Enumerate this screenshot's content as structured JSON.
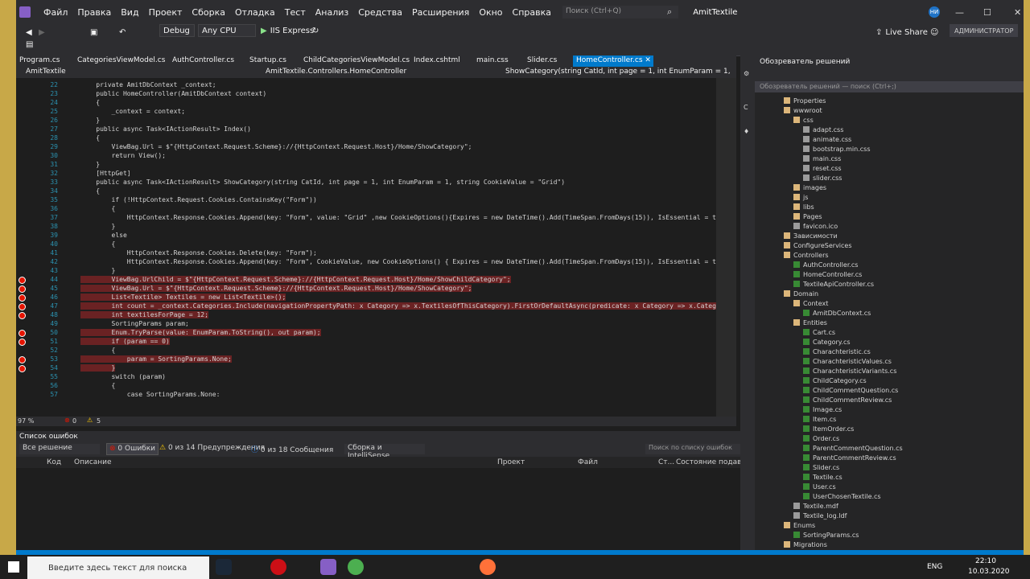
{
  "menu": {
    "items": [
      "Файл",
      "Правка",
      "Вид",
      "Проект",
      "Сборка",
      "Отладка",
      "Тест",
      "Анализ",
      "Средства",
      "Расширения",
      "Окно",
      "Справка"
    ],
    "search_placeholder": "Поиск (Ctrl+Q)",
    "solution_name": "AmitTextile",
    "user_initials": "НИ"
  },
  "toolbar": {
    "config": "Debug",
    "platform": "Any CPU",
    "run_label": "IIS Express",
    "live_share": "Live Share",
    "admin_label": "АДМИНИСТРАТОР"
  },
  "tabs": [
    "Program.cs",
    "CategoriesViewModel.cs",
    "AuthController.cs",
    "Startup.cs",
    "ChildCategoriesViewModel.cs",
    "Index.cshtml",
    "main.css",
    "Slider.cs",
    "HomeController.cs"
  ],
  "active_tab": "HomeController.cs",
  "navbar": {
    "project": "AmitTextile",
    "class": "AmitTextile.Controllers.HomeController",
    "member": "ShowCategory(string CatId, int page = 1, int EnumParam = 1, string CookieVa"
  },
  "code_lines": [
    {
      "n": "22",
      "t": "    private AmitDbContext _context;",
      "bp": false,
      "hl": false,
      "ref": "Ссылок: 0"
    },
    {
      "n": "23",
      "t": "    public HomeController(AmitDbContext context)",
      "bp": false,
      "hl": false,
      "ref": ""
    },
    {
      "n": "24",
      "t": "    {",
      "bp": false,
      "hl": false,
      "ref": ""
    },
    {
      "n": "25",
      "t": "        _context = context;",
      "bp": false,
      "hl": false,
      "ref": ""
    },
    {
      "n": "26",
      "t": "    }",
      "bp": false,
      "hl": false,
      "ref": "Ссылок: 0"
    },
    {
      "n": "27",
      "t": "    public async Task<IActionResult> Index()",
      "bp": false,
      "hl": false,
      "ref": ""
    },
    {
      "n": "28",
      "t": "    {",
      "bp": false,
      "hl": false,
      "ref": ""
    },
    {
      "n": "29",
      "t": "        ViewBag.Url = $\"{HttpContext.Request.Scheme}://{HttpContext.Request.Host}/Home/ShowCategory\";",
      "bp": false,
      "hl": false,
      "ref": ""
    },
    {
      "n": "30",
      "t": "        return View();",
      "bp": false,
      "hl": false,
      "ref": ""
    },
    {
      "n": "31",
      "t": "    }",
      "bp": false,
      "hl": false,
      "ref": ""
    },
    {
      "n": "32",
      "t": "    [HttpGet]",
      "bp": false,
      "hl": false,
      "ref": "Ссылок: 0"
    },
    {
      "n": "33",
      "t": "    public async Task<IActionResult> ShowCategory(string CatId, int page = 1, int EnumParam = 1, string CookieValue = \"Grid\")",
      "bp": false,
      "hl": false,
      "ref": ""
    },
    {
      "n": "34",
      "t": "    {",
      "bp": false,
      "hl": false,
      "ref": ""
    },
    {
      "n": "35",
      "t": "        if (!HttpContext.Request.Cookies.ContainsKey(\"Form\"))",
      "bp": false,
      "hl": false,
      "ref": ""
    },
    {
      "n": "36",
      "t": "        {",
      "bp": false,
      "hl": false,
      "ref": ""
    },
    {
      "n": "37",
      "t": "            HttpContext.Response.Cookies.Append(key: \"Form\", value: \"Grid\" ,new CookieOptions(){Expires = new DateTime().Add(TimeSpan.FromDays(15)), IsEssential = true });",
      "bp": false,
      "hl": false,
      "ref": ""
    },
    {
      "n": "38",
      "t": "        }",
      "bp": false,
      "hl": false,
      "ref": ""
    },
    {
      "n": "39",
      "t": "        else",
      "bp": false,
      "hl": false,
      "ref": ""
    },
    {
      "n": "40",
      "t": "        {",
      "bp": false,
      "hl": false,
      "ref": ""
    },
    {
      "n": "41",
      "t": "            HttpContext.Response.Cookies.Delete(key: \"Form\");",
      "bp": false,
      "hl": false,
      "ref": ""
    },
    {
      "n": "42",
      "t": "            HttpContext.Response.Cookies.Append(key: \"Form\", CookieValue, new CookieOptions() { Expires = new DateTime().Add(TimeSpan.FromDays(15)), IsEssential = true});",
      "bp": false,
      "hl": false,
      "ref": ""
    },
    {
      "n": "43",
      "t": "        }",
      "bp": false,
      "hl": false,
      "ref": ""
    },
    {
      "n": "44",
      "t": "        ViewBag.UrlChild = $\"{HttpContext.Request.Scheme}://{HttpContext.Request.Host}/Home/ShowChildCategory\";",
      "bp": true,
      "hl": true,
      "ref": ""
    },
    {
      "n": "45",
      "t": "        ViewBag.Url = $\"{HttpContext.Request.Scheme}://{HttpContext.Request.Host}/Home/ShowCategory\";",
      "bp": true,
      "hl": true,
      "ref": ""
    },
    {
      "n": "46",
      "t": "        List<Textile> Textiles = new List<Textile>();",
      "bp": true,
      "hl": true,
      "ref": ""
    },
    {
      "n": "47",
      "t": "        int count = _context.Categories.Include(navigationPropertyPath: x Category => x.TextilesOfThisCategory).FirstOrDefaultAsync(predicate: x Category => x.CategoryId == Guid.Parse(Cat",
      "bp": true,
      "hl": true,
      "ref": ""
    },
    {
      "n": "48",
      "t": "        int textilesForPage = 12;",
      "bp": true,
      "hl": true,
      "ref": ""
    },
    {
      "n": "49",
      "t": "        SortingParams param;",
      "bp": false,
      "hl": false,
      "ref": ""
    },
    {
      "n": "50",
      "t": "        Enum.TryParse(value: EnumParam.ToString(), out param);",
      "bp": true,
      "hl": true,
      "ref": ""
    },
    {
      "n": "51",
      "t": "        if (param == 0)",
      "bp": true,
      "hl": true,
      "ref": ""
    },
    {
      "n": "52",
      "t": "        {",
      "bp": false,
      "hl": false,
      "ref": ""
    },
    {
      "n": "53",
      "t": "            param = SortingParams.None;",
      "bp": true,
      "hl": true,
      "ref": ""
    },
    {
      "n": "54",
      "t": "        }",
      "bp": true,
      "hl": true,
      "ref": ""
    },
    {
      "n": "55",
      "t": "        switch (param)",
      "bp": false,
      "hl": false,
      "ref": ""
    },
    {
      "n": "56",
      "t": "        {",
      "bp": false,
      "hl": false,
      "ref": ""
    },
    {
      "n": "57",
      "t": "            case SortingParams.None:",
      "bp": false,
      "hl": false,
      "ref": ""
    }
  ],
  "editor_status": {
    "zoom": "97 %",
    "errors": "0",
    "warnings": "5"
  },
  "error_list": {
    "title": "Список ошибок",
    "scope": "Все решение",
    "errors_btn": "0 Ошибки",
    "warnings_btn": "0 из 14 Предупреждения",
    "messages_btn": "0 из 18 Сообщения",
    "build_filter": "Сборка и IntelliSense",
    "search_placeholder": "Поиск по списку ошибок",
    "columns": [
      "Код",
      "Описание",
      "Проект",
      "Файл",
      "Ст...",
      "Состояние подавл..."
    ]
  },
  "solution_explorer": {
    "title": "Обозреватель решений",
    "search_placeholder": "Обозреватель решений — поиск (Ctrl+;)",
    "nodes": [
      {
        "label": "Properties",
        "depth": 2,
        "kind": "folder"
      },
      {
        "label": "wwwroot",
        "depth": 2,
        "kind": "folder"
      },
      {
        "label": "css",
        "depth": 3,
        "kind": "folder"
      },
      {
        "label": "adapt.css",
        "depth": 4,
        "kind": "css"
      },
      {
        "label": "animate.css",
        "depth": 4,
        "kind": "css"
      },
      {
        "label": "bootstrap.min.css",
        "depth": 4,
        "kind": "css"
      },
      {
        "label": "main.css",
        "depth": 4,
        "kind": "css"
      },
      {
        "label": "reset.css",
        "depth": 4,
        "kind": "css"
      },
      {
        "label": "slider.css",
        "depth": 4,
        "kind": "css"
      },
      {
        "label": "images",
        "depth": 3,
        "kind": "folder"
      },
      {
        "label": "js",
        "depth": 3,
        "kind": "folder"
      },
      {
        "label": "libs",
        "depth": 3,
        "kind": "folder"
      },
      {
        "label": "Pages",
        "depth": 3,
        "kind": "folder"
      },
      {
        "label": "favicon.ico",
        "depth": 3,
        "kind": "css"
      },
      {
        "label": "Зависимости",
        "depth": 2,
        "kind": "folder"
      },
      {
        "label": "ConfigureServices",
        "depth": 2,
        "kind": "folder"
      },
      {
        "label": "Controllers",
        "depth": 2,
        "kind": "folder"
      },
      {
        "label": "AuthController.cs",
        "depth": 3,
        "kind": "cs"
      },
      {
        "label": "HomeController.cs",
        "depth": 3,
        "kind": "cs"
      },
      {
        "label": "TextileApiController.cs",
        "depth": 3,
        "kind": "cs"
      },
      {
        "label": "Domain",
        "depth": 2,
        "kind": "folder"
      },
      {
        "label": "Context",
        "depth": 3,
        "kind": "folder"
      },
      {
        "label": "AmitDbContext.cs",
        "depth": 4,
        "kind": "cs"
      },
      {
        "label": "Entities",
        "depth": 3,
        "kind": "folder"
      },
      {
        "label": "Cart.cs",
        "depth": 4,
        "kind": "cs"
      },
      {
        "label": "Category.cs",
        "depth": 4,
        "kind": "cs"
      },
      {
        "label": "Charachteristic.cs",
        "depth": 4,
        "kind": "cs"
      },
      {
        "label": "CharachteristicValues.cs",
        "depth": 4,
        "kind": "cs"
      },
      {
        "label": "CharachteristicVariants.cs",
        "depth": 4,
        "kind": "cs"
      },
      {
        "label": "ChildCategory.cs",
        "depth": 4,
        "kind": "cs"
      },
      {
        "label": "ChildCommentQuestion.cs",
        "depth": 4,
        "kind": "cs"
      },
      {
        "label": "ChildCommentReview.cs",
        "depth": 4,
        "kind": "cs"
      },
      {
        "label": "Image.cs",
        "depth": 4,
        "kind": "cs"
      },
      {
        "label": "Item.cs",
        "depth": 4,
        "kind": "cs"
      },
      {
        "label": "ItemOrder.cs",
        "depth": 4,
        "kind": "cs"
      },
      {
        "label": "Order.cs",
        "depth": 4,
        "kind": "cs"
      },
      {
        "label": "ParentCommentQuestion.cs",
        "depth": 4,
        "kind": "cs"
      },
      {
        "label": "ParentCommentReview.cs",
        "depth": 4,
        "kind": "cs"
      },
      {
        "label": "Slider.cs",
        "depth": 4,
        "kind": "cs"
      },
      {
        "label": "Textile.cs",
        "depth": 4,
        "kind": "cs"
      },
      {
        "label": "User.cs",
        "depth": 4,
        "kind": "cs"
      },
      {
        "label": "UserChosenTextile.cs",
        "depth": 4,
        "kind": "cs"
      },
      {
        "label": "Textile.mdf",
        "depth": 3,
        "kind": "css"
      },
      {
        "label": "Textile_log.ldf",
        "depth": 3,
        "kind": "css"
      },
      {
        "label": "Enums",
        "depth": 2,
        "kind": "folder"
      },
      {
        "label": "SortingParams.cs",
        "depth": 3,
        "kind": "cs"
      },
      {
        "label": "Migrations",
        "depth": 2,
        "kind": "folder"
      }
    ]
  },
  "status_bar": {
    "ready": "Готово",
    "line": "Стр 36",
    "col": "Стб 14",
    "ch": "Сим 14",
    "ins": "ВСТ",
    "changes": "4",
    "repo": "AmitTextile",
    "branch": "master"
  },
  "taskbar": {
    "search_placeholder": "Введите здесь текст для поиска",
    "lang": "ENG",
    "time": "22:10",
    "date": "10.03.2020"
  },
  "colors": {
    "accent": "#007acc",
    "breakpoint": "#e51400",
    "highlight": "#6a2223",
    "editor_bg": "#1e1e1e",
    "chrome": "#2d2d30"
  }
}
